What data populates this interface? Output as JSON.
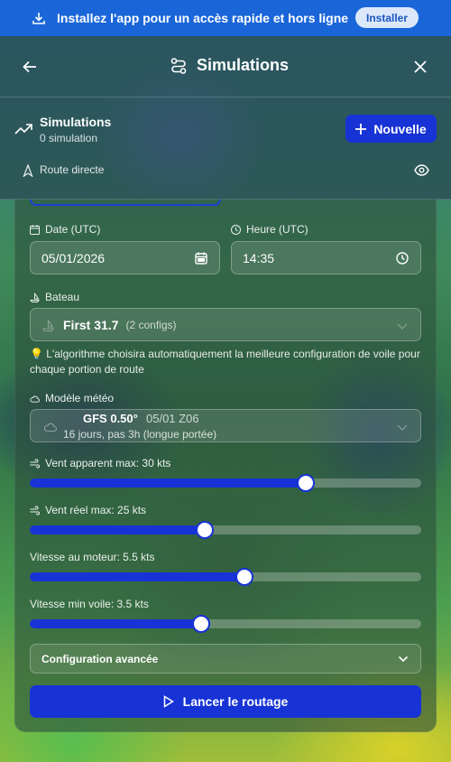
{
  "banner": {
    "text": "Installez l'app pour un accès rapide et hors ligne",
    "button": "Installer"
  },
  "header": {
    "title": "Simulations"
  },
  "simulations": {
    "title": "Simulations",
    "count": "0 simulation",
    "new_button": "Nouvelle"
  },
  "route": {
    "label": "Route directe"
  },
  "form": {
    "date_label": "Date (UTC)",
    "date_value": "05/01/2026",
    "time_label": "Heure (UTC)",
    "time_value": "14:35",
    "boat_label": "Bateau",
    "boat_name": "First 31.7",
    "boat_configs": "(2 configs)",
    "hint": "L'algorithme choisira automatiquement la meilleure configuration de voile pour chaque portion de route",
    "meteo_label": "Modèle météo",
    "meteo_name": "GFS 0.50°",
    "meteo_date": "05/01 Z06",
    "meteo_sub": "16 jours, pas 3h (longue portée)",
    "sliders": [
      {
        "label": "Vent apparent max: 30 kts",
        "fraction": 0.705
      },
      {
        "label": "Vent réel max: 25 kts",
        "fraction": 0.447
      },
      {
        "label": "Vitesse au moteur: 5.5 kts",
        "fraction": 0.548
      },
      {
        "label": "Vitesse min voile: 3.5 kts",
        "fraction": 0.438
      }
    ],
    "advanced": "Configuration avancée",
    "launch": "Lancer le routage"
  }
}
